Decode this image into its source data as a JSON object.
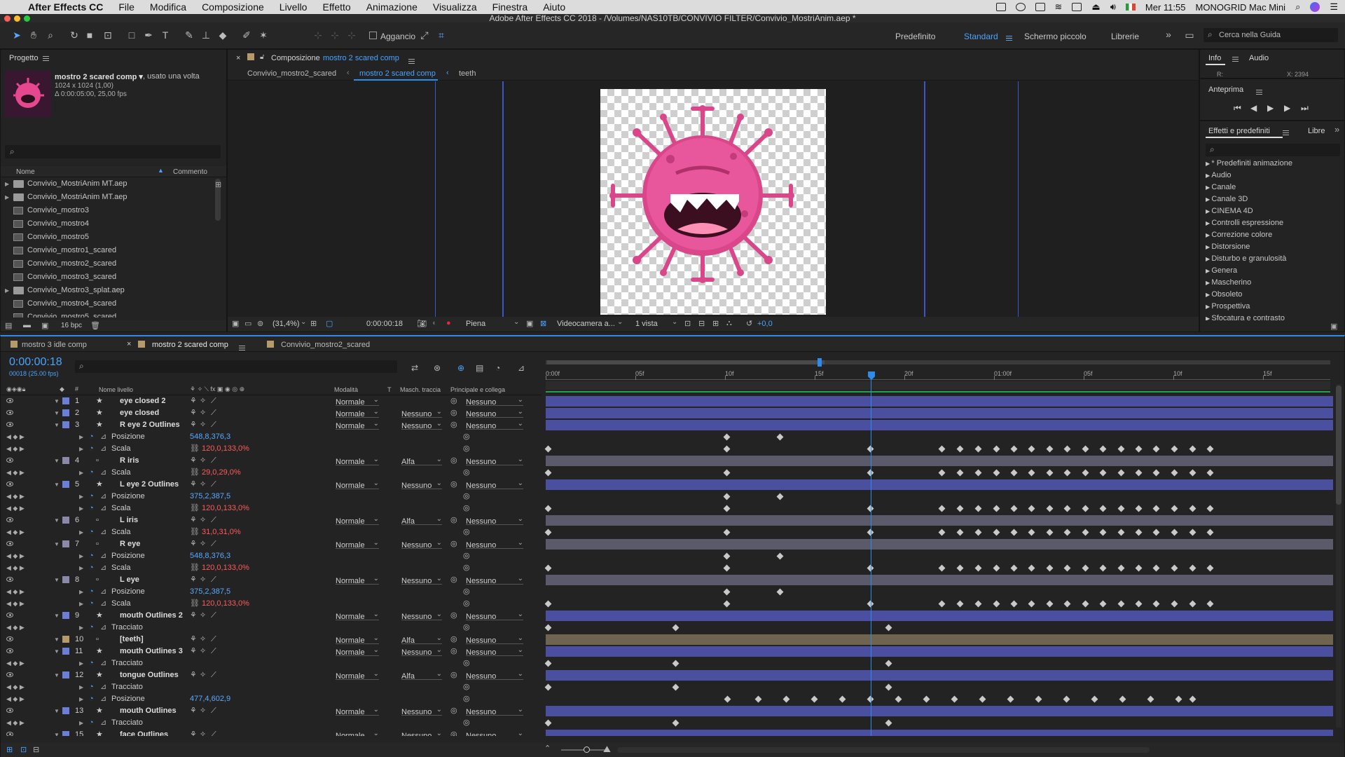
{
  "menubar": {
    "app": "After Effects CC",
    "items": [
      "File",
      "Modifica",
      "Composizione",
      "Livello",
      "Effetto",
      "Animazione",
      "Visualizza",
      "Finestra",
      "Aiuto"
    ],
    "time": "Mer 11:55",
    "user": "MONOGRID Mac Mini"
  },
  "window_title": "Adobe After Effects CC 2018 - /Volumes/NAS10TB/CONVIVIO FILTER/Convivio_MostriAnim.aep *",
  "toolbar": {
    "snap_label": "Aggancio",
    "workspaces": [
      "Predefinito",
      "Standard",
      "Schermo piccolo",
      "Librerie"
    ],
    "active_workspace": "Standard",
    "search_placeholder": "Cerca nella Guida"
  },
  "project": {
    "panel_title": "Progetto",
    "comp_name": "mostro 2 scared comp ▾",
    "used": ", usato una volta",
    "size": "1024 x 1024 (1,00)",
    "duration": "Δ 0:00:05:00, 25,00 fps",
    "search_placeholder": "",
    "col_name": "Nome",
    "col_comment": "Commento",
    "items": [
      {
        "name": "Convivio_MostriAnim MT.aep",
        "type": "folder"
      },
      {
        "name": "Convivio_MostriAnim MT.aep",
        "type": "folder"
      },
      {
        "name": "Convivio_mostro3",
        "type": "comp"
      },
      {
        "name": "Convivio_mostro4",
        "type": "comp"
      },
      {
        "name": "Convivio_mostro5",
        "type": "comp"
      },
      {
        "name": "Convivio_mostro1_scared",
        "type": "comp"
      },
      {
        "name": "Convivio_mostro2_scared",
        "type": "comp"
      },
      {
        "name": "Convivio_mostro3_scared",
        "type": "comp"
      },
      {
        "name": "Convivio_Mostro3_splat.aep",
        "type": "folder"
      },
      {
        "name": "Convivio_mostro4_scared",
        "type": "comp"
      },
      {
        "name": "Convivio_mostro5_scared",
        "type": "comp"
      }
    ],
    "bpc": "16 bpc"
  },
  "composition": {
    "panel_label": "Composizione",
    "panel_comp": "mostro 2 scared comp",
    "breadcrumbs": [
      "Convivio_mostro2_scared",
      "mostro 2 scared comp",
      "teeth"
    ],
    "zoom": "(31,4%)",
    "timecode": "0:00:00:18",
    "resolution": "Piena",
    "camera": "Videocamera a...",
    "views": "1 vista",
    "exposure": "+0,0"
  },
  "info": {
    "tabs": [
      "Info",
      "Audio"
    ],
    "readout": "X: 2394"
  },
  "preview": {
    "title": "Anteprima"
  },
  "effects": {
    "tabs": [
      "Effetti e predefiniti",
      "Libre"
    ],
    "items": [
      "* Predefiniti animazione",
      "Audio",
      "Canale",
      "Canale 3D",
      "CINEMA 4D",
      "Controlli espressione",
      "Correzione colore",
      "Distorsione",
      "Disturbo e granulosità",
      "Genera",
      "Mascherino",
      "Obsoleto",
      "Prospettiva",
      "Sfocatura e contrasto"
    ]
  },
  "timeline": {
    "tabs": [
      "mostro 3 idle comp",
      "mostro 2 scared comp",
      "Convivio_mostro2_scared"
    ],
    "timecode": "0:00:00:18",
    "frame_info": "00018 (25.00 fps)",
    "headers": {
      "name": "Nome livello",
      "mode": "Modalità",
      "t": "T",
      "track": "Masch. traccia",
      "parent": "Principale e collega"
    },
    "ruler": [
      "0:00f",
      "05f",
      "10f",
      "15f",
      "20f",
      "01:00f",
      "05f",
      "10f",
      "15f"
    ],
    "rows": [
      {
        "num": "1",
        "name": "eye closed 2",
        "mode": "Normale",
        "track": "",
        "parent": "Nessuno",
        "color": "#6b7fd6",
        "kind": "layer",
        "star": true
      },
      {
        "num": "2",
        "name": "eye closed",
        "mode": "Normale",
        "track": "Nessuno",
        "parent": "Nessuno",
        "color": "#6b7fd6",
        "kind": "layer",
        "star": true
      },
      {
        "num": "3",
        "name": "R eye 2 Outlines",
        "mode": "Normale",
        "track": "Nessuno",
        "parent": "Nessuno",
        "color": "#6b7fd6",
        "kind": "layer",
        "star": true
      },
      {
        "prop": "Posizione",
        "value": "548,8,376,3",
        "vcolor": "blue",
        "kind": "prop"
      },
      {
        "prop": "Scala",
        "value": "120,0,133,0%",
        "vcolor": "red",
        "kind": "prop"
      },
      {
        "num": "4",
        "name": "R iris",
        "mode": "Normale",
        "track": "Alfa",
        "parent": "Nessuno",
        "color": "#8a8aa8",
        "kind": "layer",
        "star": false
      },
      {
        "prop": "Scala",
        "value": "29,0,29,0%",
        "vcolor": "red",
        "kind": "prop"
      },
      {
        "num": "5",
        "name": "L eye 2 Outlines",
        "mode": "Normale",
        "track": "Nessuno",
        "parent": "Nessuno",
        "color": "#6b7fd6",
        "kind": "layer",
        "star": true
      },
      {
        "prop": "Posizione",
        "value": "375,2,387,5",
        "vcolor": "blue",
        "kind": "prop"
      },
      {
        "prop": "Scala",
        "value": "120,0,133,0%",
        "vcolor": "red",
        "kind": "prop"
      },
      {
        "num": "6",
        "name": "L iris",
        "mode": "Normale",
        "track": "Alfa",
        "parent": "Nessuno",
        "color": "#8a8aa8",
        "kind": "layer",
        "star": false
      },
      {
        "prop": "Scala",
        "value": "31,0,31,0%",
        "vcolor": "red",
        "kind": "prop"
      },
      {
        "num": "7",
        "name": "R eye",
        "mode": "Normale",
        "track": "Nessuno",
        "parent": "Nessuno",
        "color": "#8a8aa8",
        "kind": "layer",
        "star": false
      },
      {
        "prop": "Posizione",
        "value": "548,8,376,3",
        "vcolor": "blue",
        "kind": "prop"
      },
      {
        "prop": "Scala",
        "value": "120,0,133,0%",
        "vcolor": "red",
        "kind": "prop"
      },
      {
        "num": "8",
        "name": "L eye",
        "mode": "Normale",
        "track": "Nessuno",
        "parent": "Nessuno",
        "color": "#8a8aa8",
        "kind": "layer",
        "star": false
      },
      {
        "prop": "Posizione",
        "value": "375,2,387,5",
        "vcolor": "blue",
        "kind": "prop"
      },
      {
        "prop": "Scala",
        "value": "120,0,133,0%",
        "vcolor": "red",
        "kind": "prop"
      },
      {
        "num": "9",
        "name": "mouth Outlines 2",
        "mode": "Normale",
        "track": "Nessuno",
        "parent": "Nessuno",
        "color": "#6b7fd6",
        "kind": "layer",
        "star": true
      },
      {
        "prop": "Tracciato",
        "value": "",
        "vcolor": "blue",
        "kind": "prop"
      },
      {
        "num": "10",
        "name": "[teeth]",
        "mode": "Normale",
        "track": "Alfa",
        "parent": "Nessuno",
        "color": "#b79a6a",
        "kind": "layer",
        "star": false
      },
      {
        "num": "11",
        "name": "mouth Outlines 3",
        "mode": "Normale",
        "track": "Nessuno",
        "parent": "Nessuno",
        "color": "#6b7fd6",
        "kind": "layer",
        "star": true
      },
      {
        "prop": "Tracciato",
        "value": "",
        "vcolor": "blue",
        "kind": "prop"
      },
      {
        "num": "12",
        "name": "tongue Outlines",
        "mode": "Normale",
        "track": "Alfa",
        "parent": "Nessuno",
        "color": "#6b7fd6",
        "kind": "layer",
        "star": true
      },
      {
        "prop": "Tracciato",
        "value": "",
        "vcolor": "blue",
        "kind": "prop"
      },
      {
        "prop": "Posizione",
        "value": "477,4,602,9",
        "vcolor": "blue",
        "kind": "prop"
      },
      {
        "num": "13",
        "name": "mouth Outlines",
        "mode": "Normale",
        "track": "Nessuno",
        "parent": "Nessuno",
        "color": "#6b7fd6",
        "kind": "layer",
        "star": true
      },
      {
        "prop": "Tracciato",
        "value": "",
        "vcolor": "blue",
        "kind": "prop"
      },
      {
        "num": "15",
        "name": "face Outlines",
        "mode": "Normale",
        "track": "Nessuno",
        "parent": "Nessuno",
        "color": "#6b7fd6",
        "kind": "layer",
        "star": true
      }
    ]
  },
  "colors": {
    "accent": "#2d8ceb",
    "bar_blue": "#4b4fa0",
    "bar_gray": "#5a5a6a",
    "bar_tan": "#6e6450",
    "canvas_pink": "#e6488f"
  }
}
